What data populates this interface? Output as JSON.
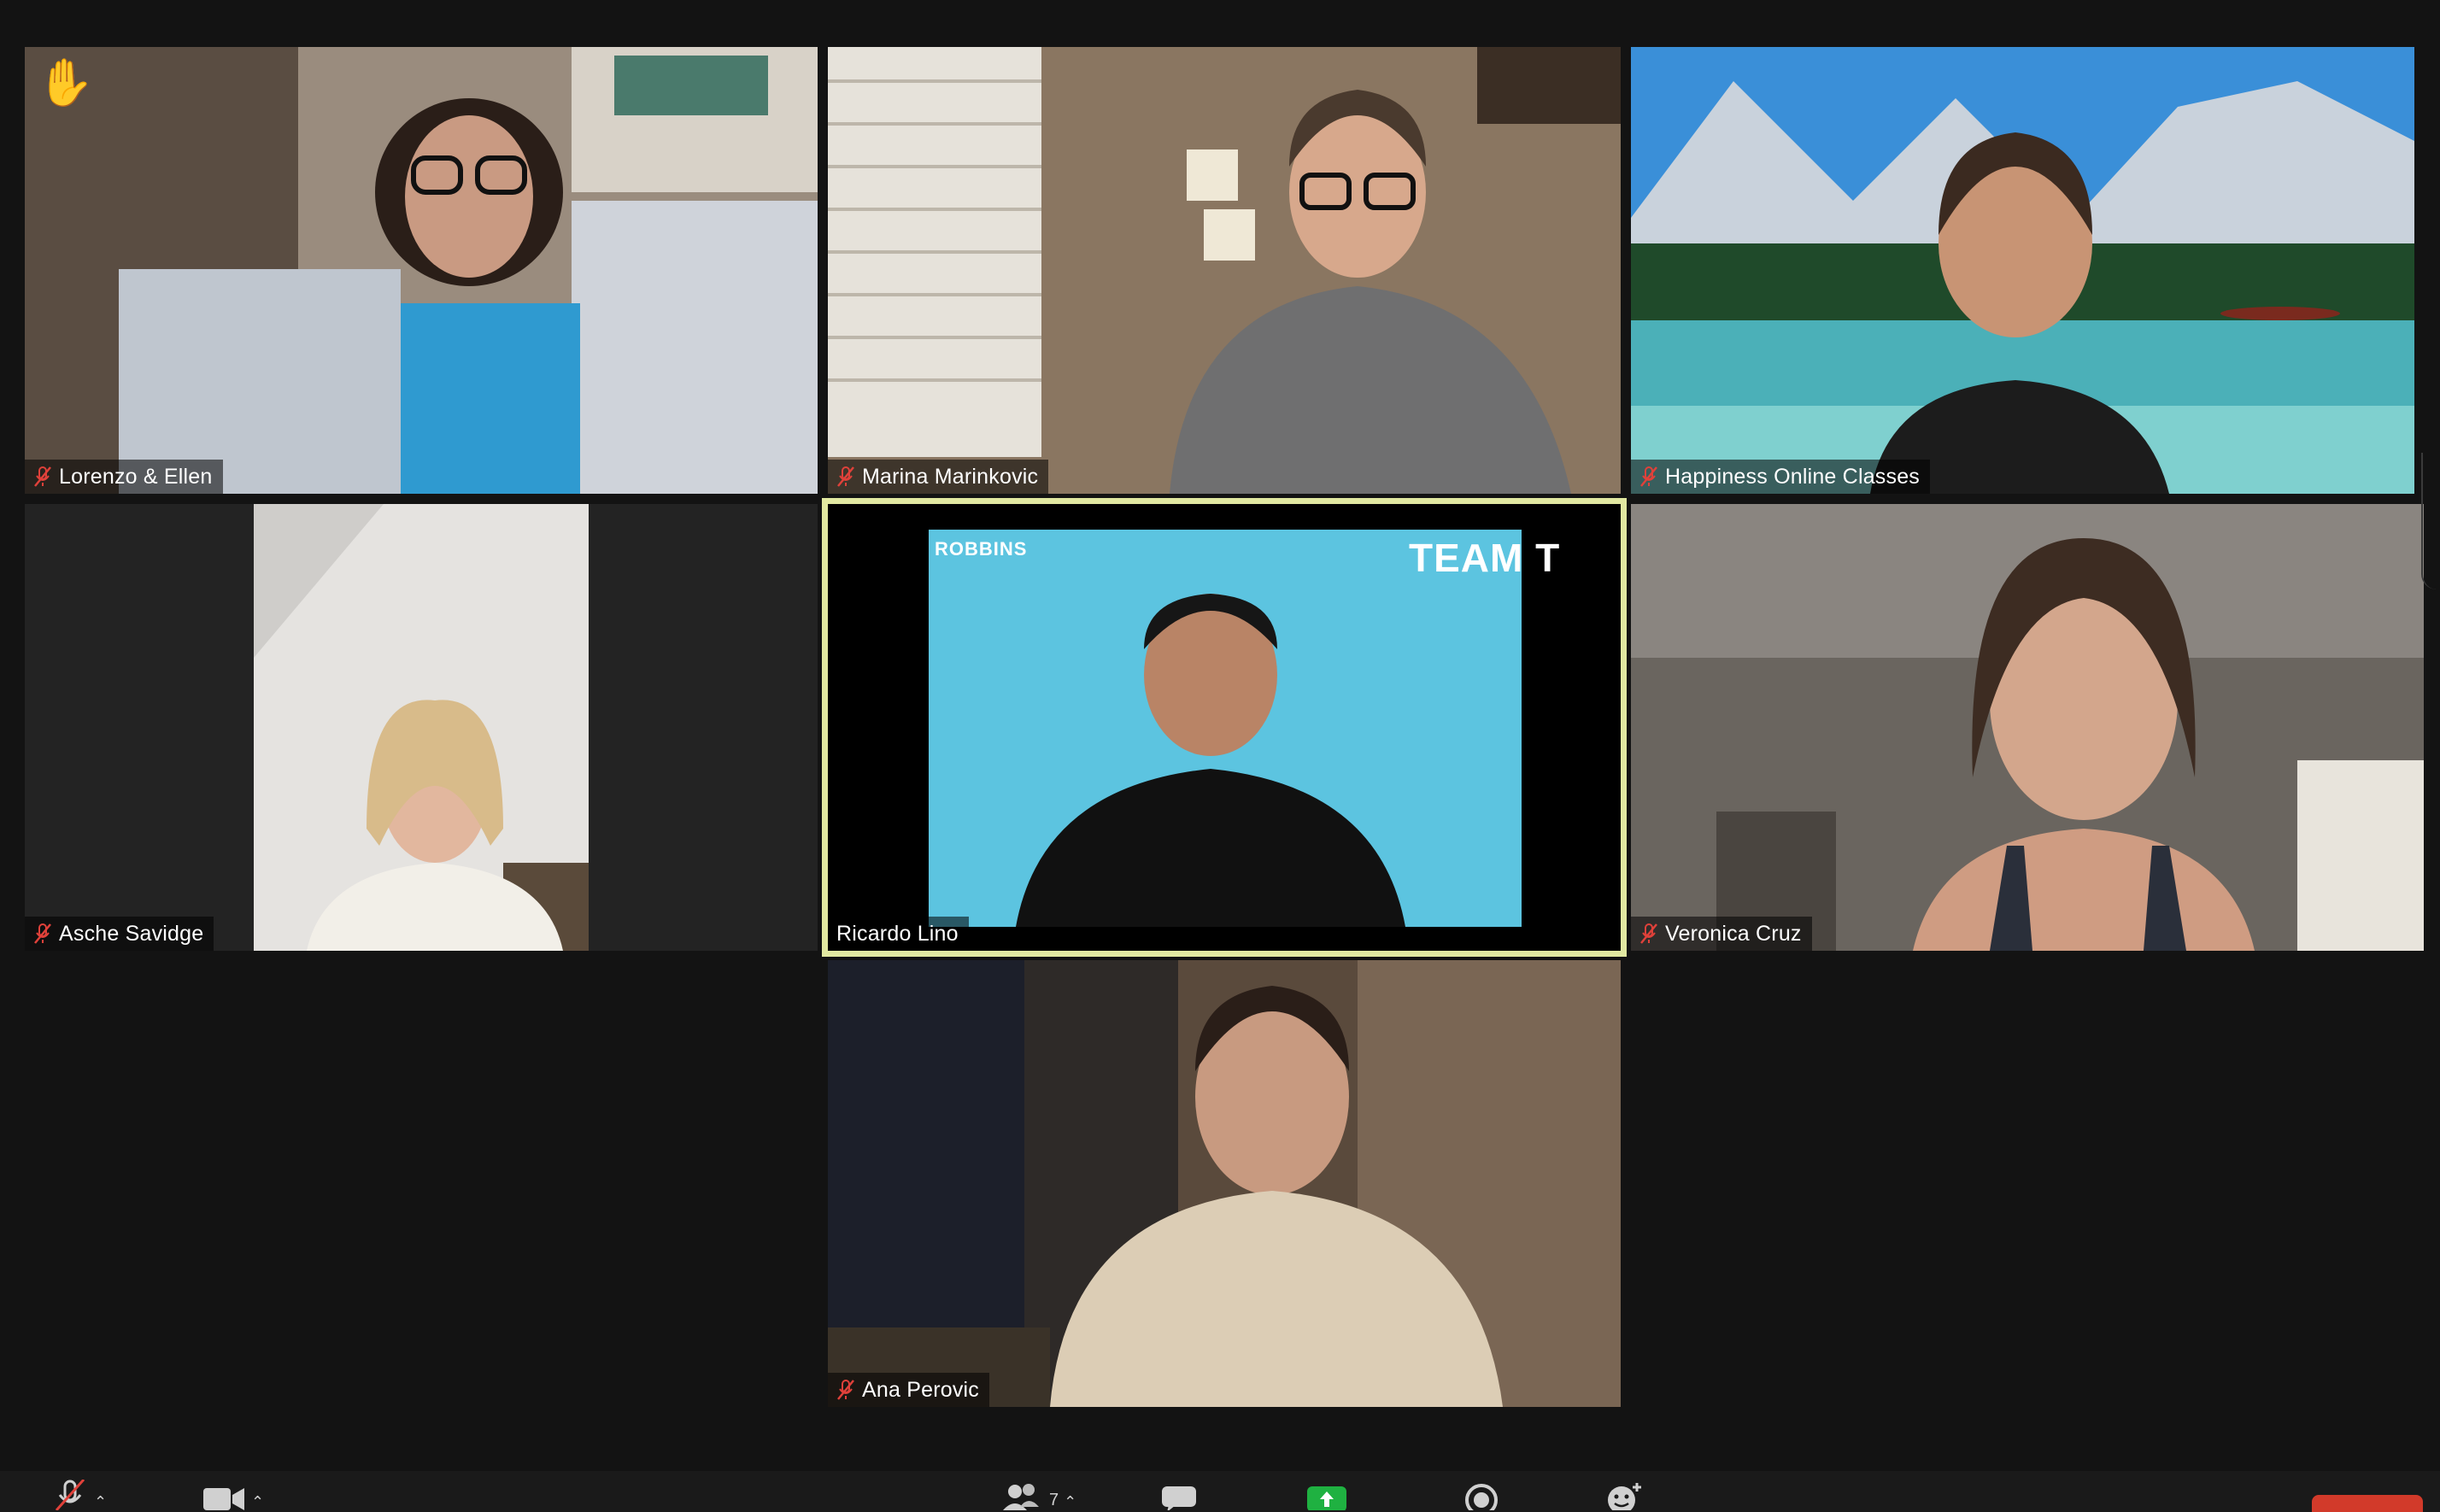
{
  "participants": [
    {
      "name": "Lorenzo & Ellen",
      "muted": true,
      "raised_hand": true
    },
    {
      "name": "Marina Marinkovic",
      "muted": true
    },
    {
      "name": "Happiness Online Classes",
      "muted": true
    },
    {
      "name": "Asche Savidge",
      "muted": true
    },
    {
      "name": "Ricardo Lino",
      "muted": false,
      "active_speaker": true,
      "video_text_left": "ROBBINS",
      "video_text_right": "TEAM T"
    },
    {
      "name": "Veronica Cruz",
      "muted": true
    },
    {
      "name": "Ana Perovic",
      "muted": true
    }
  ],
  "toolbar": {
    "participant_count": "7",
    "icons": [
      "microphone-muted-icon",
      "video-camera-icon",
      "participants-icon",
      "chat-icon",
      "share-screen-icon",
      "record-icon",
      "reactions-icon"
    ]
  },
  "colors": {
    "background": "#131313",
    "active_speaker_border": "#e1e8a1",
    "muted_icon": "#e0413a",
    "share_green": "#1fb141",
    "end_red": "#d23a2a"
  }
}
